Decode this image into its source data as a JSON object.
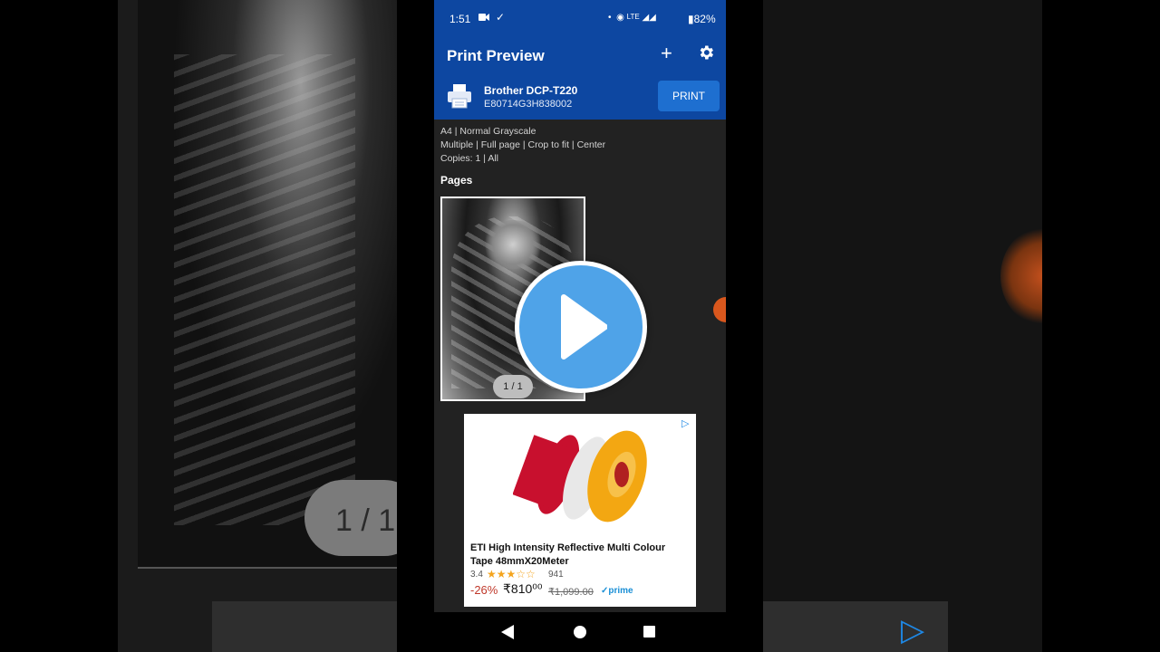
{
  "background_left": {
    "page_counter": "1 / 1"
  },
  "status_bar": {
    "time": "1:51",
    "network": "LTE",
    "battery": "82%"
  },
  "app_bar": {
    "title": "Print Preview",
    "add_icon": "plus-icon",
    "settings_icon": "gear-icon"
  },
  "printer": {
    "name": "Brother DCP-T220",
    "serial": "E80714G3H838002",
    "print_label": "PRINT"
  },
  "settings": {
    "line1": "A4 | Normal Grayscale",
    "line2": "Multiple | Full page | Crop to fit | Center",
    "line3": "Copies: 1 | All"
  },
  "pages": {
    "heading": "Pages",
    "counter": "1 / 1"
  },
  "ad": {
    "title": "ETI High Intensity Reflective Multi Colour Tape 48mmX20Meter",
    "rating": "3.4",
    "rating_value": 3.4,
    "rating_count": "941",
    "discount": "-26%",
    "price": "₹810⁰⁰",
    "mrp": "₹1,099.00",
    "prime": "✓prime"
  },
  "colors": {
    "app_blue": "#0d47a1",
    "print_button": "#1e6fd0",
    "play_button": "#4fa3e8"
  }
}
